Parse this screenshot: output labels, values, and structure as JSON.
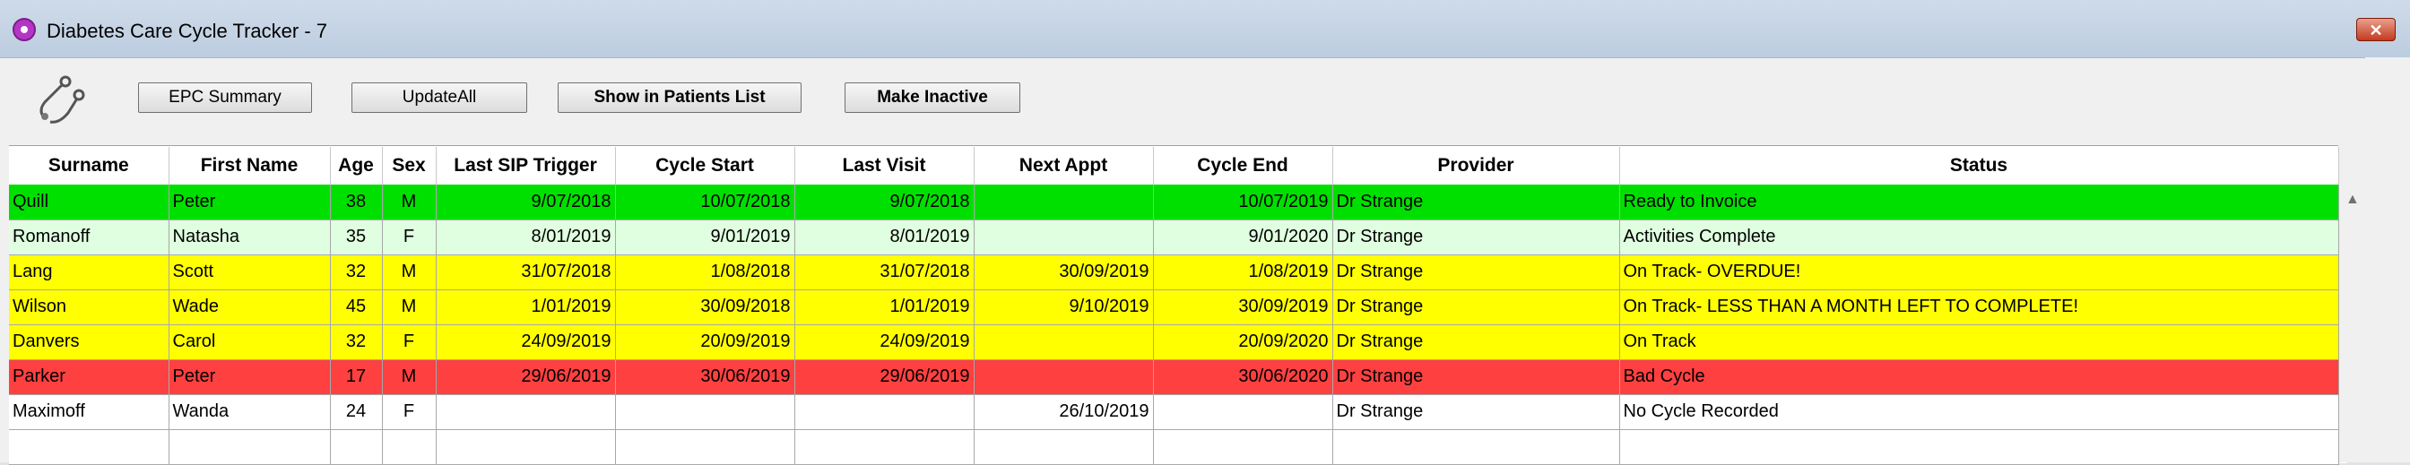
{
  "window": {
    "title": "Diabetes Care Cycle Tracker - 7",
    "close_label": "✕"
  },
  "toolbar": {
    "epc_summary": "EPC Summary",
    "update_all": "UpdateAll",
    "show_in_patients_list": "Show in Patients List",
    "make_inactive": "Make Inactive"
  },
  "colors": {
    "ready_to_invoice": "#00e000",
    "activities_complete": "#e0ffe0",
    "on_track": "#ffff00",
    "bad_cycle": "#ff4040",
    "no_cycle": "#ffffff"
  },
  "table": {
    "headers": [
      "Surname",
      "First Name",
      "Age",
      "Sex",
      "Last SIP Trigger",
      "Cycle Start",
      "Last Visit",
      "Next Appt",
      "Cycle End",
      "Provider",
      "Status"
    ],
    "rows": [
      [
        "Quill",
        "Peter",
        "38",
        "M",
        "9/07/2018",
        "10/07/2018",
        "9/07/2018",
        "",
        "10/07/2019",
        "Dr Strange",
        "Ready to Invoice"
      ],
      [
        "Romanoff",
        "Natasha",
        "35",
        "F",
        "8/01/2019",
        "9/01/2019",
        "8/01/2019",
        "",
        "9/01/2020",
        "Dr Strange",
        "Activities Complete"
      ],
      [
        "Lang",
        "Scott",
        "32",
        "M",
        "31/07/2018",
        "1/08/2018",
        "31/07/2018",
        "30/09/2019",
        "1/08/2019",
        "Dr Strange",
        "On Track- OVERDUE!"
      ],
      [
        "Wilson",
        "Wade",
        "45",
        "M",
        "1/01/2019",
        "30/09/2018",
        "1/01/2019",
        "9/10/2019",
        "30/09/2019",
        "Dr Strange",
        "On Track- LESS THAN A MONTH LEFT TO COMPLETE!"
      ],
      [
        "Danvers",
        "Carol",
        "32",
        "F",
        "24/09/2019",
        "20/09/2019",
        "24/09/2019",
        "",
        "20/09/2020",
        "Dr Strange",
        "On Track"
      ],
      [
        "Parker",
        "Peter",
        "17",
        "M",
        "29/06/2019",
        "30/06/2019",
        "29/06/2019",
        "",
        "30/06/2020",
        "Dr Strange",
        "Bad Cycle"
      ],
      [
        "Maximoff",
        "Wanda",
        "24",
        "F",
        "",
        "",
        "",
        "26/10/2019",
        "",
        "Dr Strange",
        "No Cycle Recorded"
      ]
    ]
  }
}
